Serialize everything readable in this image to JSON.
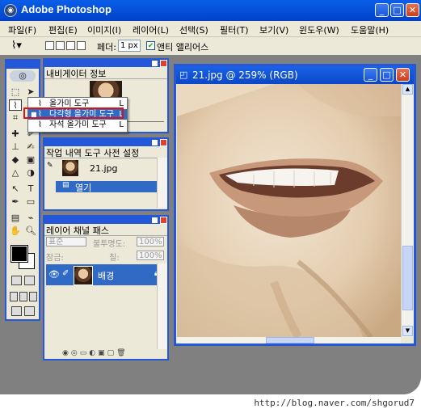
{
  "app": {
    "title": "Adobe Photoshop"
  },
  "menu": [
    "파일(F)",
    "편집(E)",
    "이미지(I)",
    "레이어(L)",
    "선택(S)",
    "필터(T)",
    "보기(V)",
    "윈도우(W)",
    "도움말(H)"
  ],
  "options": {
    "feather_label": "페더:",
    "feather_value": "1 px",
    "antialias_label": "앤티 앨리어스",
    "antialias_checked": true
  },
  "flyout": {
    "items": [
      {
        "label": "올가미 도구",
        "key": "L",
        "selected": false
      },
      {
        "label": "다각형 올가미 도구",
        "key": "L",
        "selected": true
      },
      {
        "label": "자석 올가미 도구",
        "key": "L",
        "selected": false
      }
    ]
  },
  "navigator_panel": {
    "tab": "내비게이터 정보"
  },
  "history_panel": {
    "tabs": "작업 내역 도구 사전 설정",
    "snapshot": "21.jpg",
    "state": "열기"
  },
  "layers_panel": {
    "tabs": "레이어 채널 패스",
    "blend_mode": "표준",
    "opacity_label": "불투명도:",
    "opacity_value": "100%",
    "lock_label": "잠금:",
    "fill_label": "칠:",
    "fill_value": "100%",
    "layer_name": "배경"
  },
  "document": {
    "title": "21.jpg @ 259% (RGB)"
  },
  "watermark": "http://blog.naver.com/shgorud7",
  "colors": {
    "titlebar": "#0a5ee8",
    "panel_border": "#2458d8",
    "chrome": "#ece9d8",
    "selection": "#316ac5",
    "highlight_box": "#e01010"
  }
}
